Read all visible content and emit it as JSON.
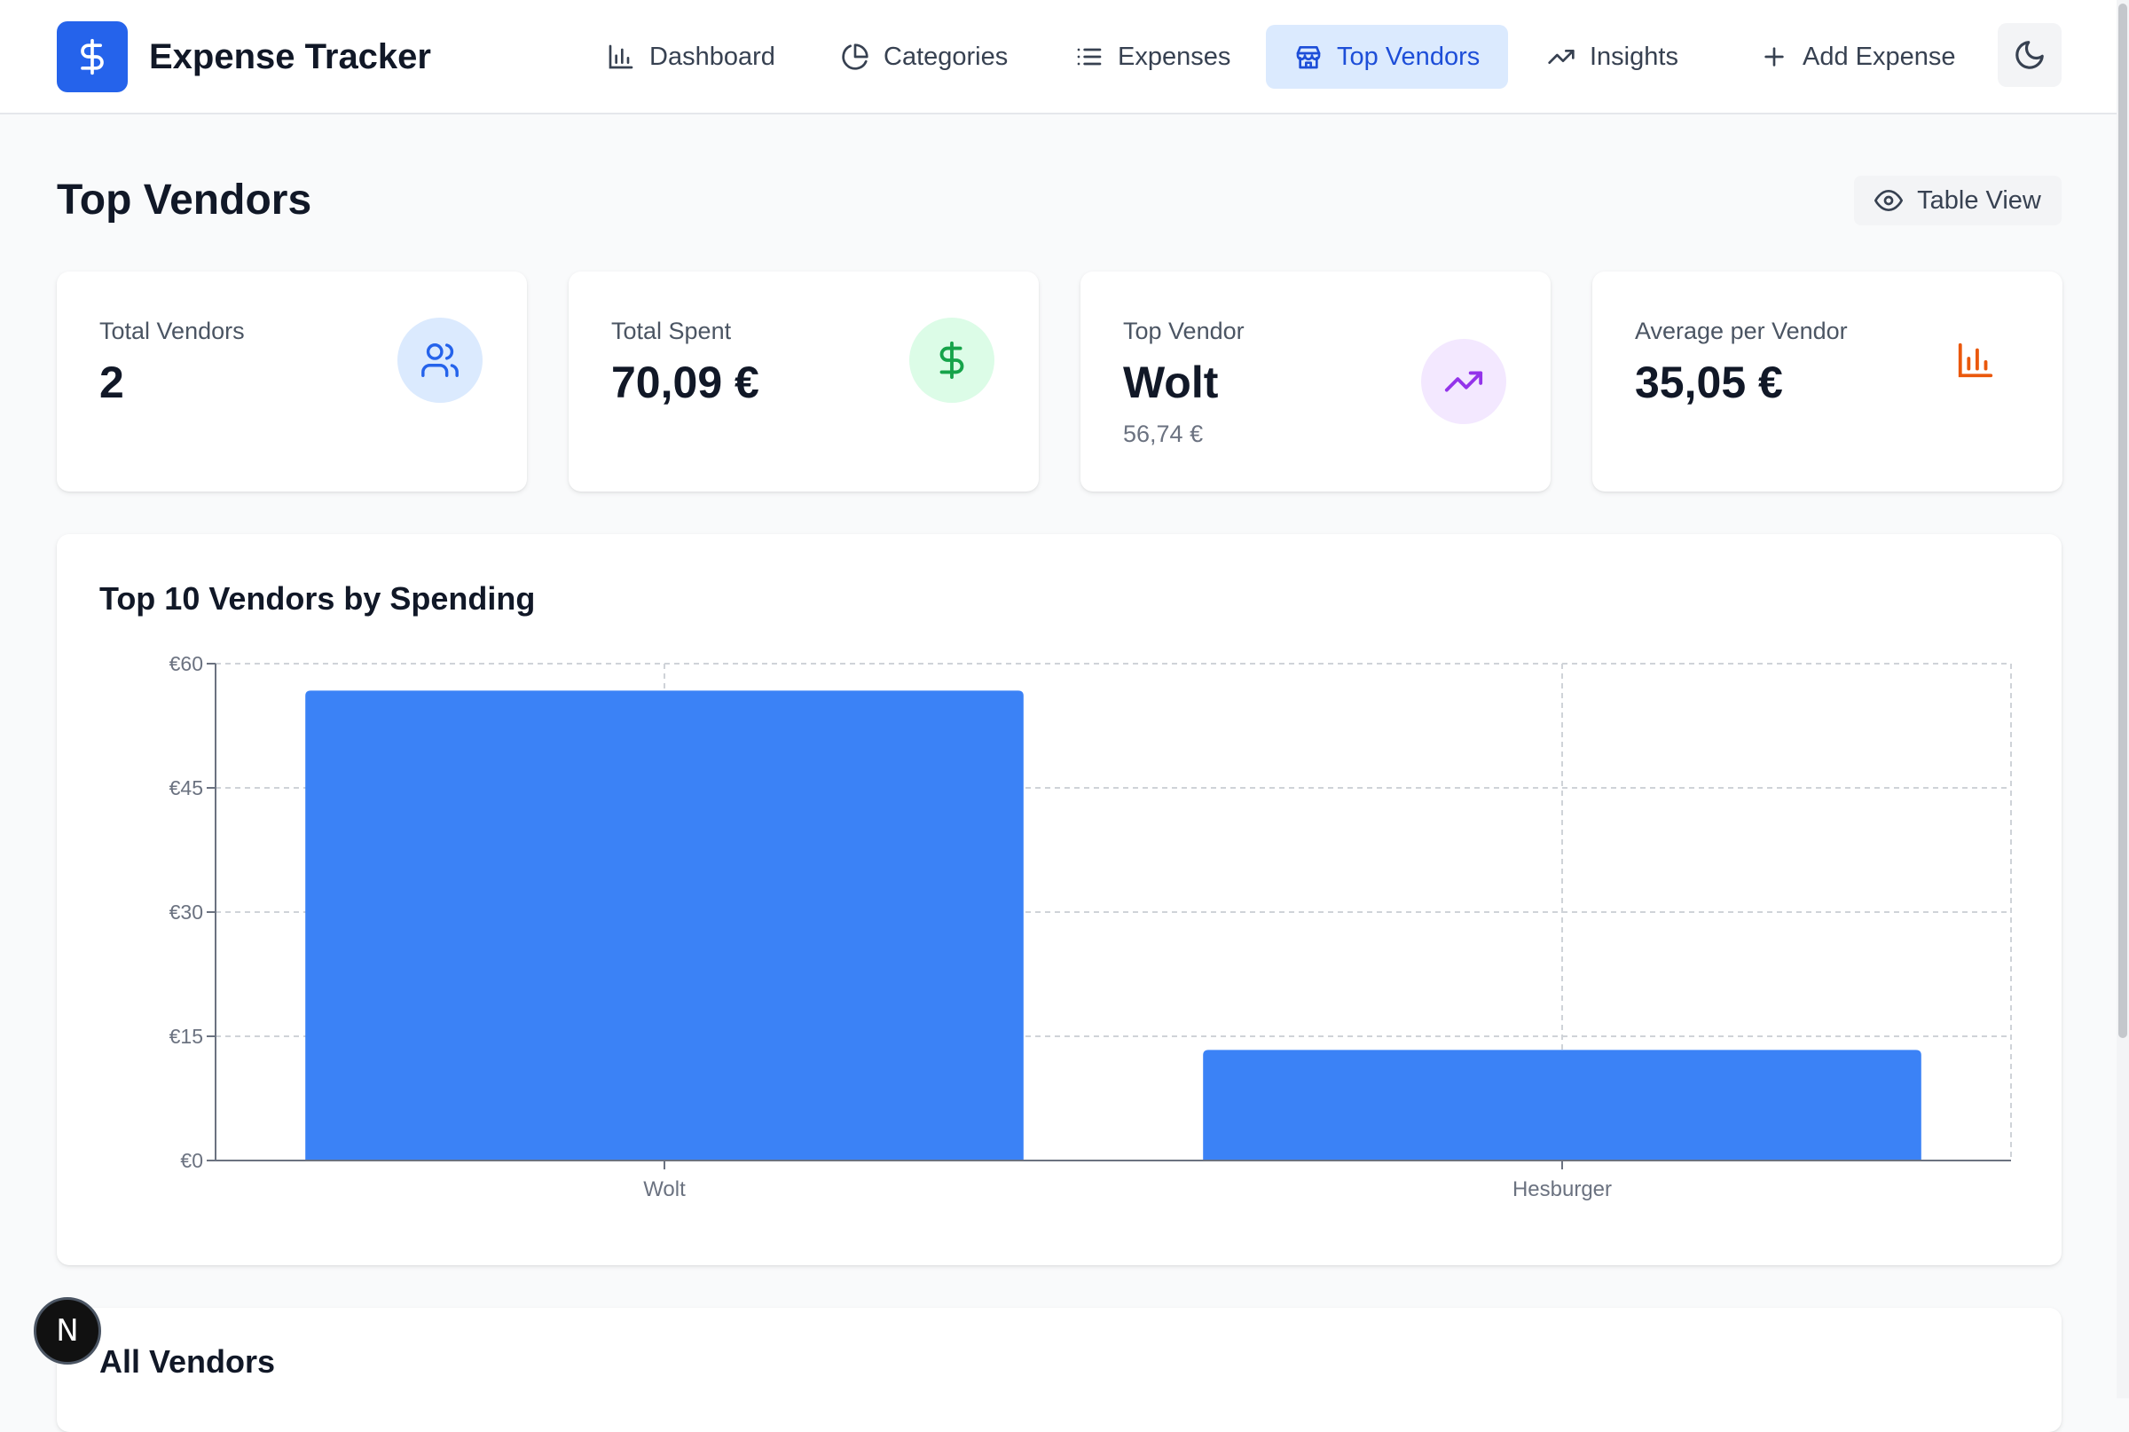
{
  "app": {
    "name": "Expense Tracker",
    "logo_icon": "dollar-icon",
    "brand_color": "#2563eb"
  },
  "nav": {
    "items": [
      {
        "label": "Dashboard",
        "icon": "bar-chart-icon",
        "active": false
      },
      {
        "label": "Categories",
        "icon": "pie-chart-icon",
        "active": false
      },
      {
        "label": "Expenses",
        "icon": "list-icon",
        "active": false
      },
      {
        "label": "Top Vendors",
        "icon": "store-icon",
        "active": true
      },
      {
        "label": "Insights",
        "icon": "trending-up-icon",
        "active": false
      },
      {
        "label": "Add Expense",
        "icon": "plus-icon",
        "active": false
      }
    ],
    "theme_toggle_icon": "moon-icon"
  },
  "page": {
    "title": "Top Vendors",
    "table_view_label": "Table View",
    "table_view_icon": "eye-icon"
  },
  "stats": [
    {
      "label": "Total Vendors",
      "value": "2",
      "sub": "",
      "icon": "users-icon",
      "icon_color": "#2563eb",
      "icon_bg": "#dbeafe"
    },
    {
      "label": "Total Spent",
      "value": "70,09 €",
      "sub": "",
      "icon": "dollar-icon",
      "icon_color": "#16a34a",
      "icon_bg": "#dcfce7"
    },
    {
      "label": "Top Vendor",
      "value": "Wolt",
      "sub": "56,74 €",
      "icon": "trending-up-icon",
      "icon_color": "#9333ea",
      "icon_bg": "#f3e8ff"
    },
    {
      "label": "Average per Vendor",
      "value": "35,05 €",
      "sub": "",
      "icon": "bar-chart-icon",
      "icon_color": "#ea580c",
      "icon_bg": ""
    }
  ],
  "chart_data": {
    "type": "bar",
    "title": "Top 10 Vendors by Spending",
    "categories": [
      "Wolt",
      "Hesburger"
    ],
    "values": [
      56.74,
      13.35
    ],
    "ylim": [
      0,
      60
    ],
    "yticks": [
      0,
      15,
      30,
      45,
      60
    ],
    "ytick_labels": [
      "€0",
      "€15",
      "€30",
      "€45",
      "€60"
    ],
    "bar_color": "#3b82f6",
    "grid": true,
    "legend": "none"
  },
  "vendors_section": {
    "title": "All Vendors"
  },
  "dev_badge": {
    "label": "N"
  }
}
